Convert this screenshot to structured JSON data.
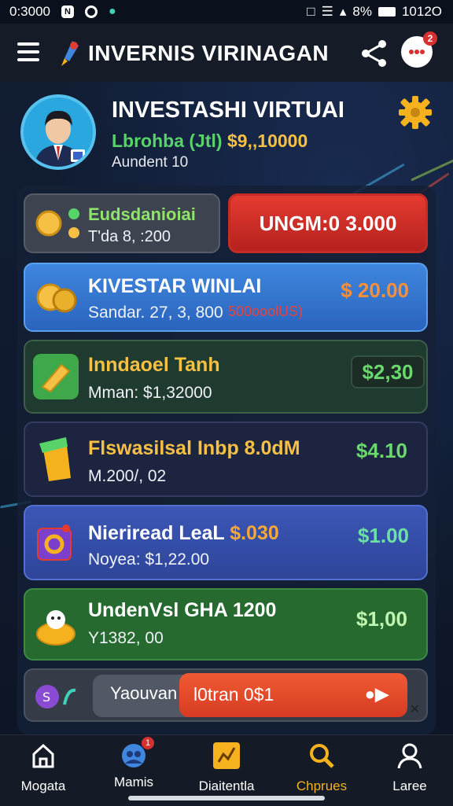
{
  "status_bar": {
    "time_left": "0:3000",
    "battery_percent": "8%",
    "time_right": "1012O"
  },
  "app_bar": {
    "title": "INVERNIS VIRINAGAN",
    "notification_count": "2"
  },
  "profile": {
    "name": "INVESTASHI VIRTUAI",
    "line1_label": "Lbrohba (Jtl)",
    "line1_value": "$9,,10000",
    "line2": "Aundent 10"
  },
  "summary_card": {
    "title": "Eudsdanioiai",
    "subtitle": "T'da 8, :200",
    "button_label": "UNGM:0 3.000"
  },
  "items": [
    {
      "title": "KIVESTAR WINLAI",
      "subtitle": "Sandar. 27, 3, 800",
      "tag": "500ooolUS)",
      "price": "$ 20.00"
    },
    {
      "title": "Inndaoel Tanh",
      "subtitle": "Mman: $1,32000",
      "price": "$2,30"
    },
    {
      "title": "Flswasilsal Inbp 8.0dM",
      "subtitle": "M.200/, 02",
      "price": "$4.10"
    },
    {
      "title_part1": "Nieriread LeaL",
      "title_part2": "$.030",
      "subtitle": "Noyea: $1,22.00",
      "price": "$1.00"
    },
    {
      "title": "UndenVsl GHA 1200",
      "subtitle": "Y1382, 00",
      "price": "$1,00"
    }
  ],
  "bottom_action": {
    "label": "Yaouvan",
    "button_label": "l0tran 0$1"
  },
  "bottom_nav": [
    {
      "label": "Mogata",
      "icon": "home-icon"
    },
    {
      "label": "Mamis",
      "icon": "users-icon",
      "badge": "1"
    },
    {
      "label": "Diaitentla",
      "icon": "chart-icon"
    },
    {
      "label": "Chprues",
      "icon": "search-icon",
      "active": true
    },
    {
      "label": "Laree",
      "icon": "profile-icon"
    }
  ],
  "colors": {
    "accent_yellow": "#f5c043",
    "accent_green": "#58d36a",
    "accent_red": "#e43b31"
  }
}
